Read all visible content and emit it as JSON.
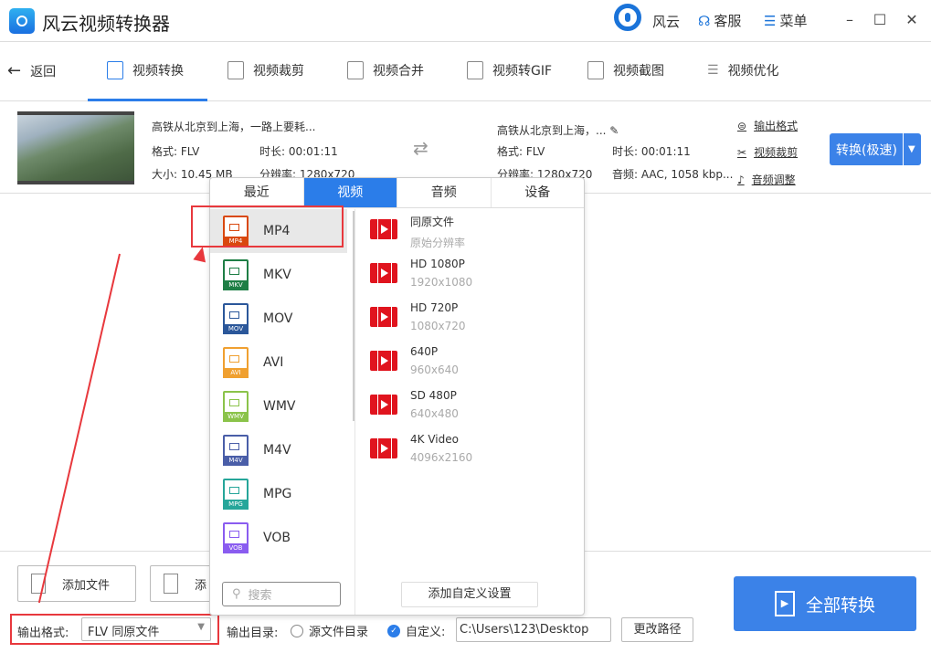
{
  "app": {
    "title": "风云视频转换器",
    "brand": "风云",
    "service": "客服",
    "menu": "菜单"
  },
  "nav": {
    "back": "返回",
    "items": [
      "视频转换",
      "视频裁剪",
      "视频合并",
      "视频转GIF",
      "视频截图",
      "视频优化"
    ]
  },
  "file": {
    "name": "高铁从北京到上海，一路上要耗...",
    "format": "格式: FLV",
    "duration": "时长: 00:01:11",
    "size": "大小: 10.45 MB",
    "resolution": "分辨率: 1280x720"
  },
  "output": {
    "name": "高铁从北京到上海，...",
    "format": "格式: FLV",
    "duration": "时长: 00:01:11",
    "resolution": "分辨率: 1280x720",
    "audio": "音频: AAC, 1058 kbp..."
  },
  "actions": {
    "output_format": "输出格式",
    "video_cut": "视频裁剪",
    "audio_adjust": "音频调整",
    "convert": "转换(极速)"
  },
  "popup": {
    "tabs": [
      "最近",
      "视频",
      "音频",
      "设备"
    ],
    "formats": [
      {
        "name": "MP4",
        "color": "#d9480f"
      },
      {
        "name": "MKV",
        "color": "#1e7e45"
      },
      {
        "name": "MOV",
        "color": "#2b579a"
      },
      {
        "name": "AVI",
        "color": "#f0a030"
      },
      {
        "name": "WMV",
        "color": "#8bc34a"
      },
      {
        "name": "M4V",
        "color": "#4a5ea8"
      },
      {
        "name": "MPG",
        "color": "#26a69a"
      },
      {
        "name": "VOB",
        "color": "#8a5cf0"
      }
    ],
    "presets": [
      {
        "name": "同原文件",
        "sub": "原始分辨率"
      },
      {
        "name": "HD 1080P",
        "sub": "1920x1080"
      },
      {
        "name": "HD 720P",
        "sub": "1080x720"
      },
      {
        "name": "640P",
        "sub": "960x640"
      },
      {
        "name": "SD 480P",
        "sub": "640x480"
      },
      {
        "name": "4K Video",
        "sub": "4096x2160"
      }
    ],
    "search_placeholder": "搜索",
    "custom": "添加自定义设置"
  },
  "bottom": {
    "add_file": "添加文件",
    "add_folder": "添",
    "format_label": "输出格式:",
    "format_value": "FLV 同原文件",
    "dir_label": "输出目录:",
    "source_dir": "源文件目录",
    "custom": "自定义:",
    "path": "C:\\Users\\123\\Desktop",
    "change_path": "更改路径",
    "convert_all": "全部转换"
  }
}
